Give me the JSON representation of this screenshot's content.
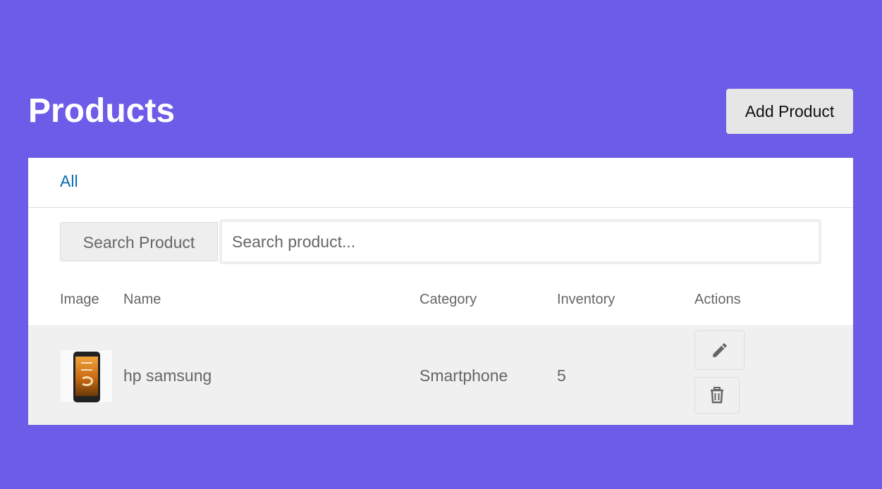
{
  "header": {
    "title": "Products",
    "add_button_label": "Add Product"
  },
  "tabs": {
    "all_label": "All"
  },
  "search": {
    "label": "Search Product",
    "placeholder": "Search product..."
  },
  "table": {
    "columns": [
      "Image",
      "Name",
      "Category",
      "Inventory",
      "Actions"
    ],
    "rows": [
      {
        "image_icon": "smartphone-image",
        "name": "hp samsung",
        "category": "Smartphone",
        "inventory": "5",
        "actions": [
          "pencil-icon",
          "trash-icon"
        ]
      }
    ]
  },
  "colors": {
    "background": "#6c5ce7",
    "link": "#0a6ab0",
    "row_background": "#f0f0f0"
  }
}
